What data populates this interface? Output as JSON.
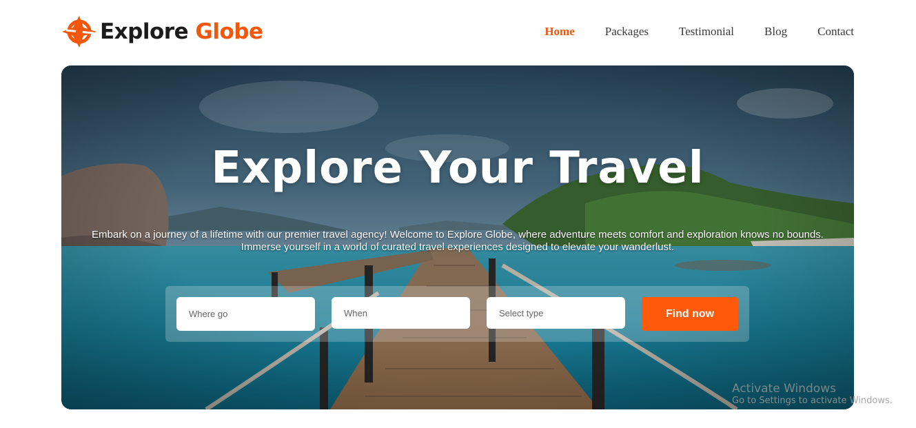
{
  "brand": {
    "name_part1": "Explore",
    "name_part2": "Globe",
    "icon": "globe-plane-icon",
    "accent_color": "#f4560a"
  },
  "nav": {
    "items": [
      {
        "label": "Home",
        "active": true
      },
      {
        "label": "Packages",
        "active": false
      },
      {
        "label": "Testimonial",
        "active": false
      },
      {
        "label": "Blog",
        "active": false
      },
      {
        "label": "Contact",
        "active": false
      }
    ]
  },
  "hero": {
    "title": "Explore Your Travel",
    "description_line1": "Embark on a journey of a lifetime with our premier travel agency! Welcome to Explore Globe, where adventure meets comfort and exploration knows no bounds.",
    "description_line2": "Immerse yourself in a world of curated travel experiences designed to elevate your wanderlust."
  },
  "search": {
    "where_placeholder": "Where go",
    "when_placeholder": "When",
    "type_placeholder": "Select type",
    "button_label": "Find now",
    "button_color": "#ff5a0a"
  },
  "watermark": {
    "line1": "Activate Windows",
    "line2": "Go to Settings to activate Windows."
  }
}
